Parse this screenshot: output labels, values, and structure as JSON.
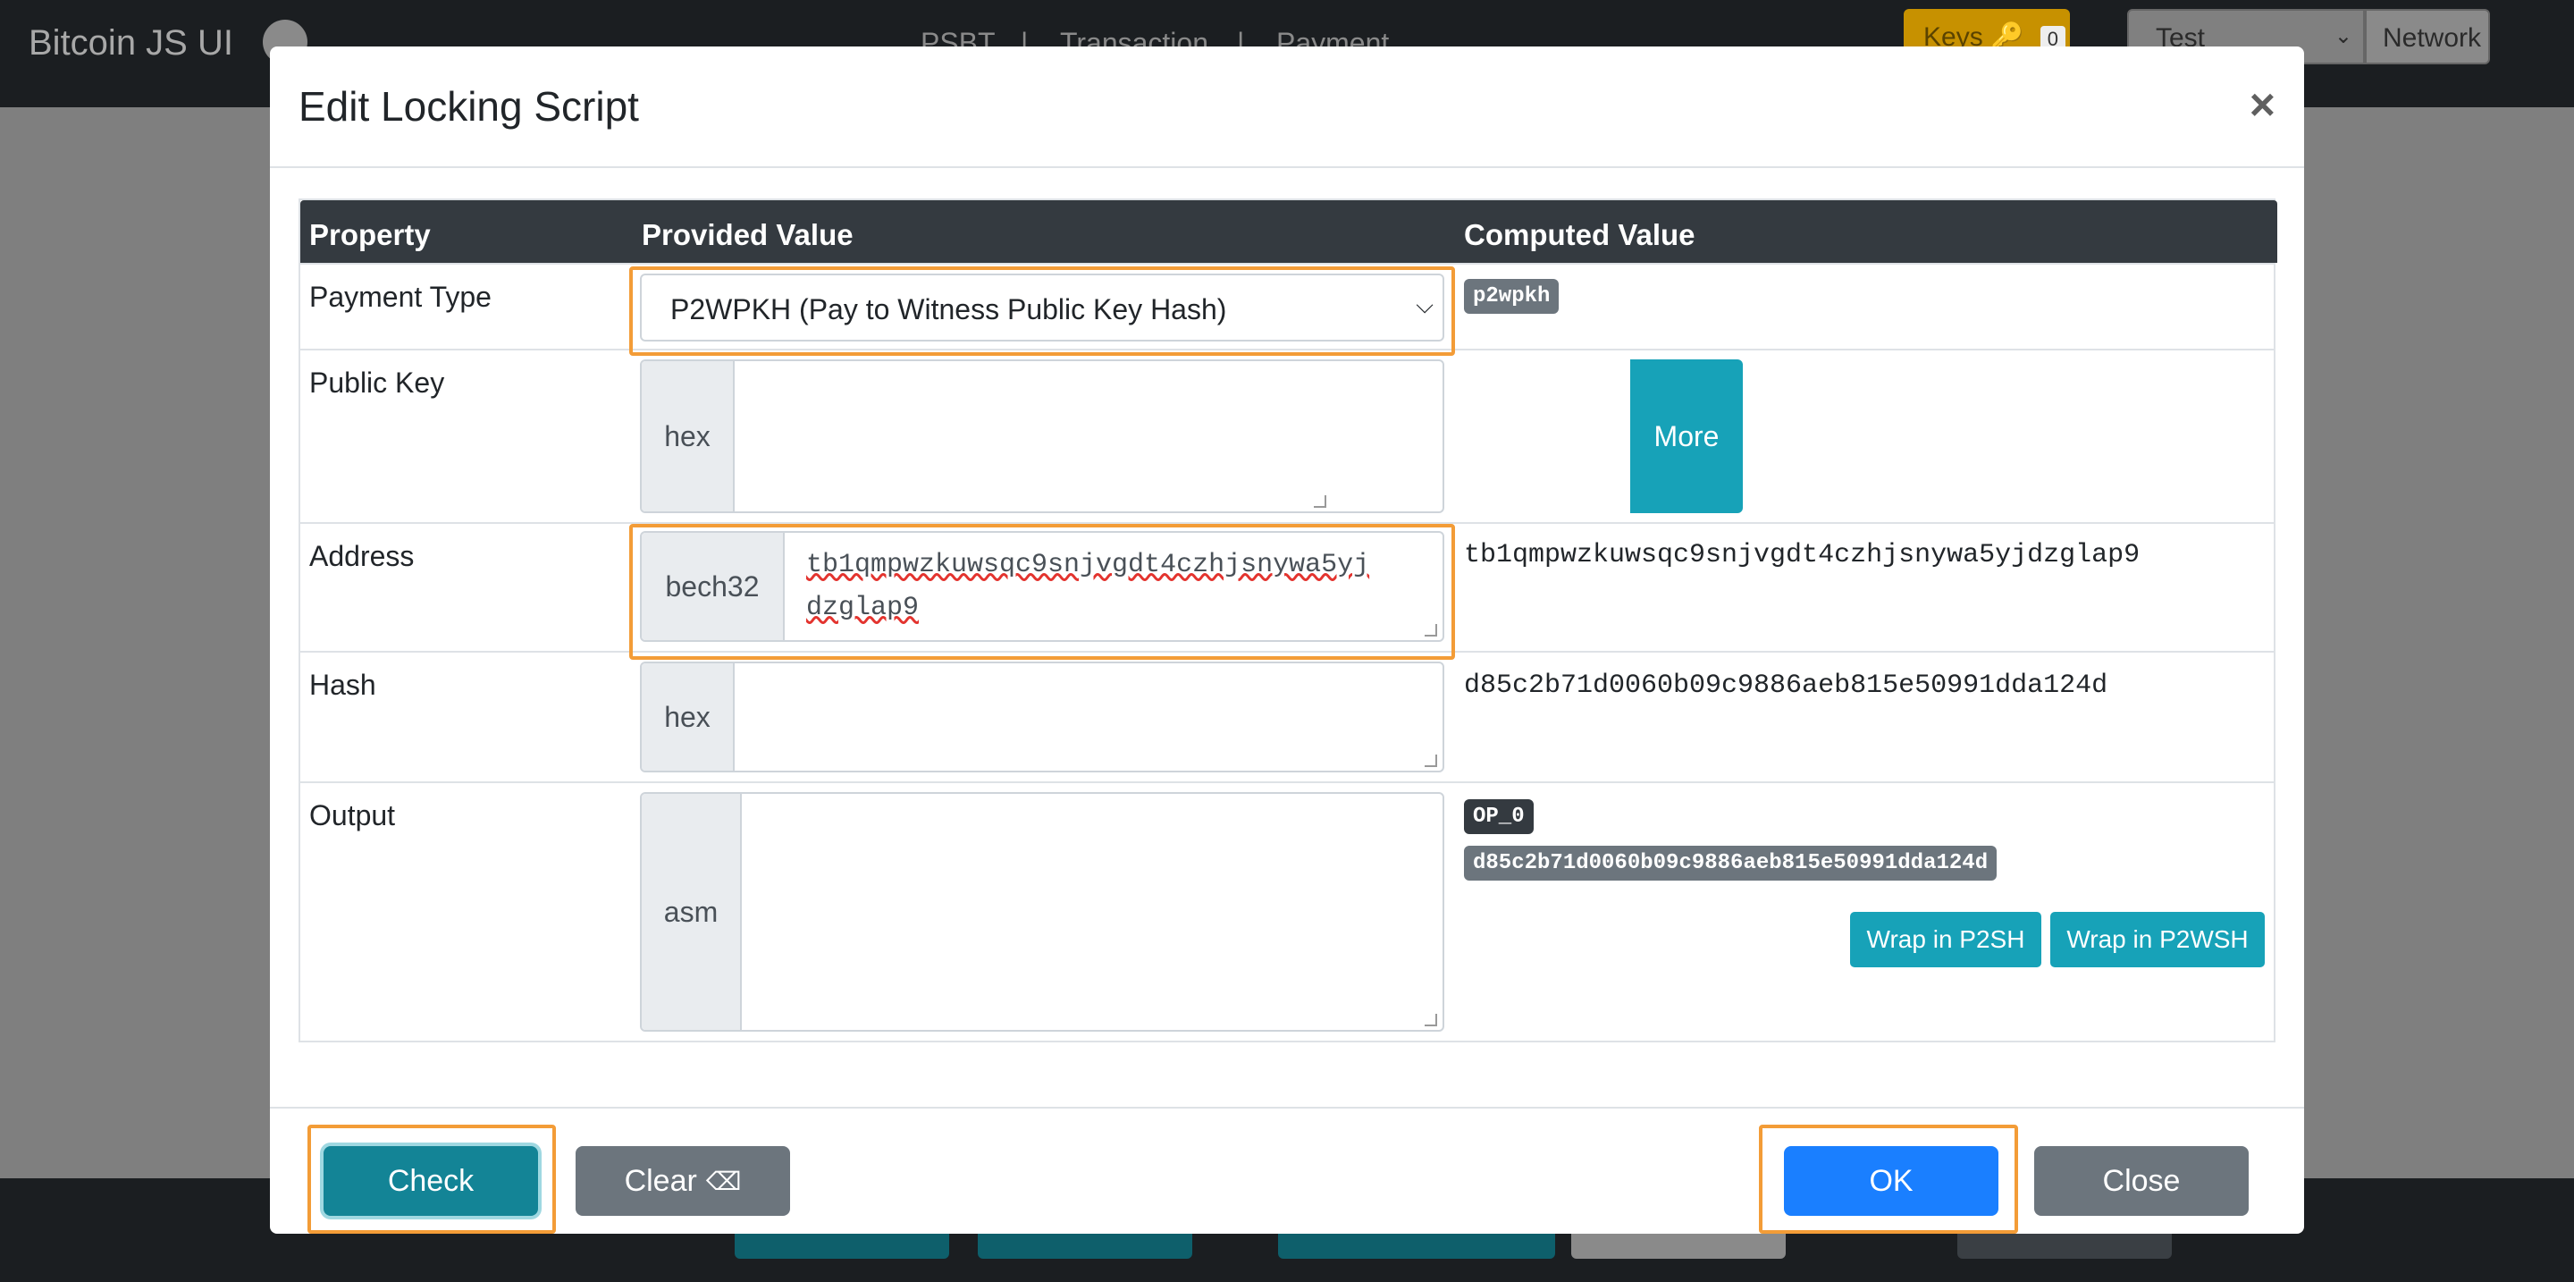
{
  "app": {
    "brand": "Bitcoin JS UI",
    "nav": [
      "PSBT",
      "|",
      "Transaction",
      "|",
      "Payment"
    ],
    "keys_label": "Keys",
    "keys_count": "0",
    "network_value": "Test",
    "network_label": "Network"
  },
  "modal": {
    "title": "Edit Locking Script",
    "close_symbol": "×",
    "table": {
      "headers": [
        "Property",
        "Provided Value",
        "Computed Value"
      ],
      "payment_type": {
        "label": "Payment Type",
        "selected": "P2WPKH (Pay to Witness Public Key Hash)",
        "computed_badge": "p2wpkh"
      },
      "public_key": {
        "label": "Public Key",
        "prefix": "hex",
        "value": "",
        "more_label": "More"
      },
      "address": {
        "label": "Address",
        "prefix": "bech32",
        "value_line1": "tb1qmpwzkuwsqc9snjvgdt4czhjsnywa5yj",
        "value_line2": "dzglap9",
        "computed": "tb1qmpwzkuwsqc9snjvgdt4czhjsnywa5yjdzglap9"
      },
      "hash": {
        "label": "Hash",
        "prefix": "hex",
        "value": "",
        "computed": "d85c2b71d0060b09c9886aeb815e50991dda124d"
      },
      "output": {
        "label": "Output",
        "prefix": "asm",
        "value": "",
        "computed_op": "OP_0",
        "computed_hash": "d85c2b71d0060b09c9886aeb815e50991dda124d",
        "wrap_p2sh": "Wrap in P2SH",
        "wrap_p2wsh": "Wrap in P2WSH"
      }
    },
    "footer": {
      "check": "Check",
      "clear": "Clear",
      "ok": "OK",
      "close": "Close"
    }
  },
  "colors": {
    "info": "#17a2b8",
    "primary": "#1a7fff",
    "secondary": "#6c757d",
    "highlight": "#f39c37",
    "dark": "#343a40"
  }
}
